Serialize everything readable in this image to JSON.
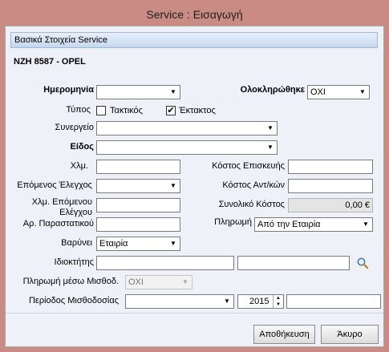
{
  "window": {
    "title": "Service : Εισαγωγή"
  },
  "section": {
    "title": "Βασικά Στοιχεία Service"
  },
  "vehicle": {
    "plate": "ΝΖΗ 8587 - OPEL"
  },
  "fields": {
    "date_label": "Ημερομηνία",
    "date_value": "",
    "completed_label": "Ολοκληρώθηκε",
    "completed_value": "ΟΧΙ",
    "type_label": "Τύπος",
    "type_regular_label": "Τακτικός",
    "type_regular_checked": false,
    "type_extra_label": "Έκτακτος",
    "type_extra_checked": true,
    "garage_label": "Συνεργείο",
    "garage_value": "",
    "kind_label": "Είδος",
    "kind_value": "",
    "km_label": "Χλμ.",
    "km_value": "",
    "repair_cost_label": "Κόστος Επισκευής",
    "repair_cost_value": "",
    "next_check_label": "Επόμενος Έλεγχος",
    "next_check_value": "",
    "parts_cost_label": "Κόστος Αντ/κών",
    "parts_cost_value": "",
    "next_check_km_label": "Χλμ. Επόμενου Ελέγχου",
    "next_check_km_value": "",
    "total_cost_label": "Συνολικό Κόστος",
    "total_cost_value": "0,00 €",
    "receipt_no_label": "Αρ. Παραστατικού",
    "receipt_no_value": "",
    "payment_label": "Πληρωμή",
    "payment_value": "Από την Εταιρία",
    "charged_label": "Βαρύνει",
    "charged_value": "Εταιρία",
    "owner_label": "Ιδιοκτήτης",
    "owner_value_1": "",
    "owner_value_2": "",
    "payroll_payment_label": "Πληρωμή μέσω Μισθοδ.",
    "payroll_payment_value": "ΟΧΙ",
    "payroll_period_label": "Περίοδος Μισθοδοσίας",
    "payroll_period_value": "",
    "payroll_year_value": "2015",
    "payroll_extra_value": ""
  },
  "buttons": {
    "save": "Αποθήκευση",
    "cancel": "Άκυρο"
  },
  "icons": {
    "dropdown": "chevron-down-icon",
    "search": "magnifier-icon",
    "check": "checkmark-icon"
  }
}
